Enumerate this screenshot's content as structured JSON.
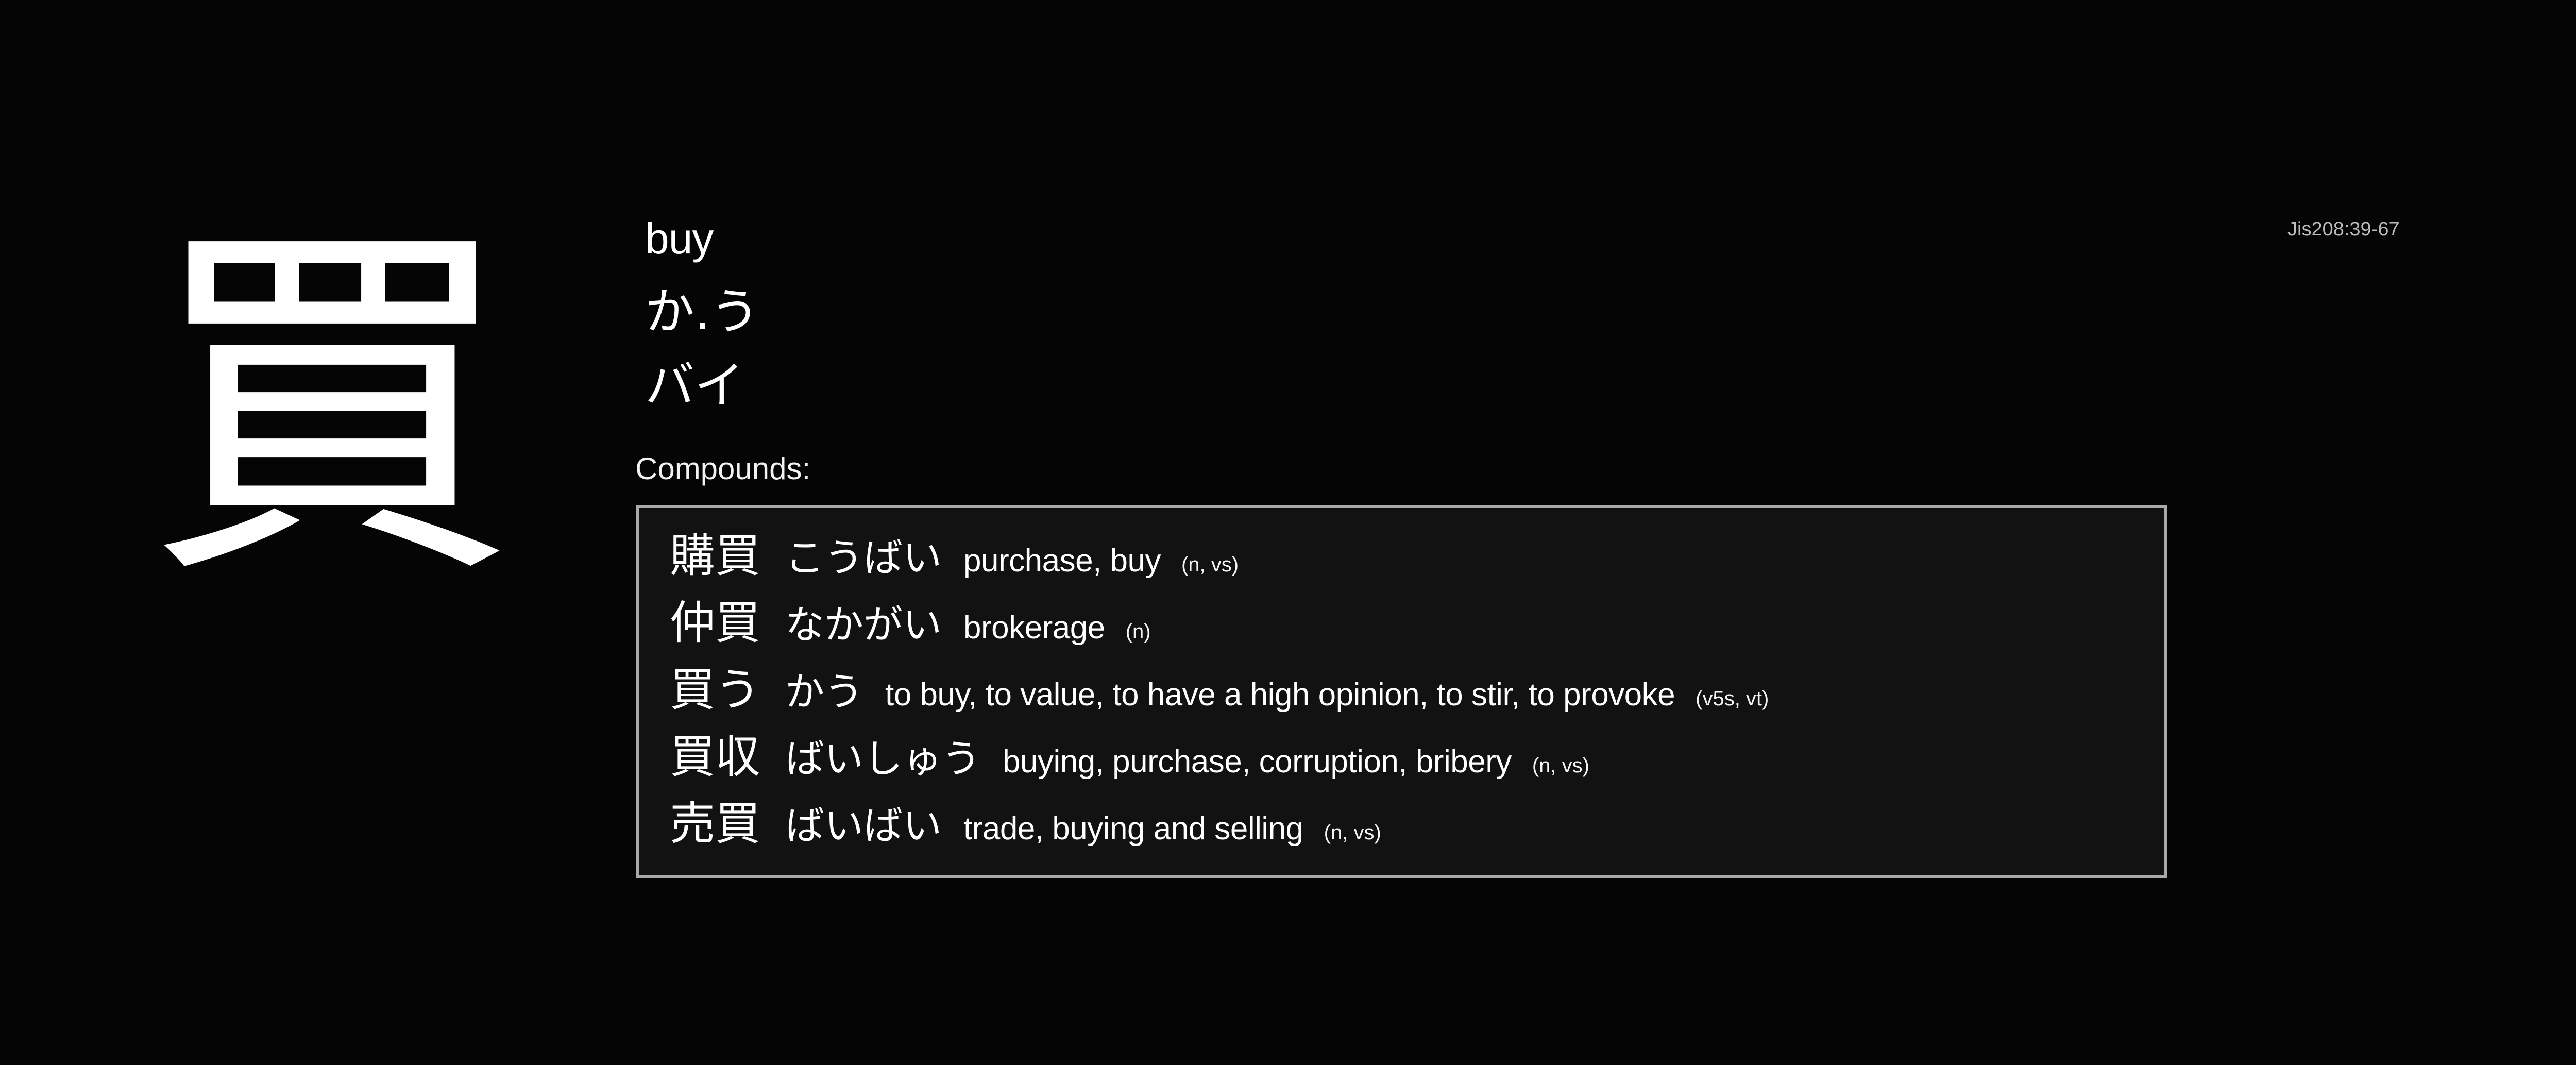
{
  "kanji": {
    "character": "買",
    "meaning": "buy",
    "kun_reading": "か.う",
    "on_reading": "バイ",
    "jis_code": "Jis208:39-67"
  },
  "compounds": {
    "label": "Compounds:",
    "items": [
      {
        "word": "購買",
        "reading": "こうばい",
        "gloss": "purchase, buy",
        "pos": "(n, vs)"
      },
      {
        "word": "仲買",
        "reading": "なかがい",
        "gloss": "brokerage",
        "pos": "(n)"
      },
      {
        "word": "買う",
        "reading": "かう",
        "gloss": "to buy, to value, to have a high opinion, to stir, to provoke",
        "pos": "(v5s, vt)"
      },
      {
        "word": "買収",
        "reading": "ばいしゅう",
        "gloss": "buying, purchase, corruption, bribery",
        "pos": "(n, vs)"
      },
      {
        "word": "売買",
        "reading": "ばいばい",
        "gloss": "trade, buying and selling",
        "pos": "(n, vs)"
      }
    ]
  }
}
